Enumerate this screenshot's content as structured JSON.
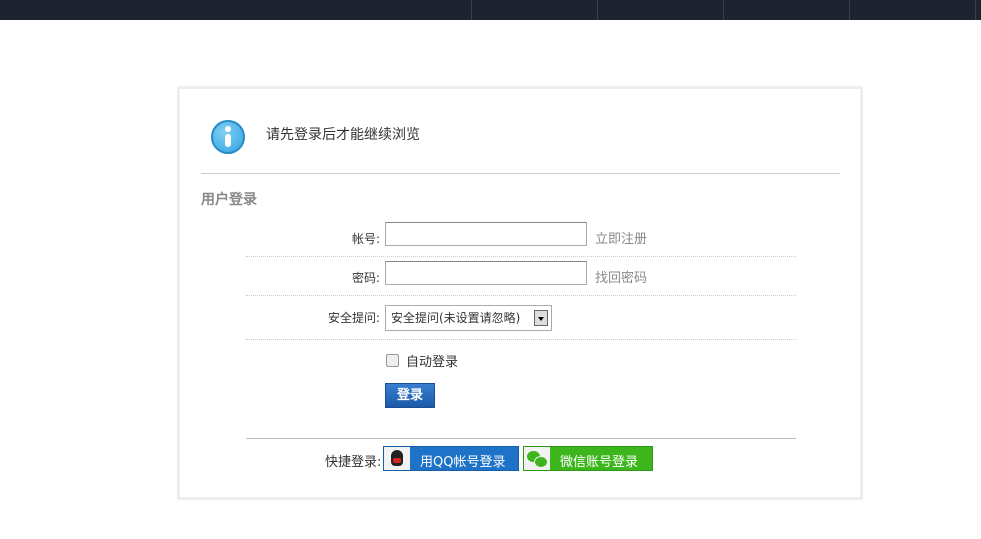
{
  "notice": "请先登录后才能继续浏览",
  "section_title": "用户登录",
  "form": {
    "account_label": "帐号:",
    "account_value": "",
    "register_link": "立即注册",
    "password_label": "密码:",
    "password_value": "",
    "forgot_link": "找回密码",
    "question_label": "安全提问:",
    "question_selected": "安全提问(未设置请忽略)",
    "auto_login_label": "自动登录",
    "auto_login_checked": false,
    "login_button": "登录"
  },
  "quick": {
    "label": "快捷登录:",
    "qq_button": "用QQ帐号登录",
    "wechat_button": "微信账号登录"
  }
}
